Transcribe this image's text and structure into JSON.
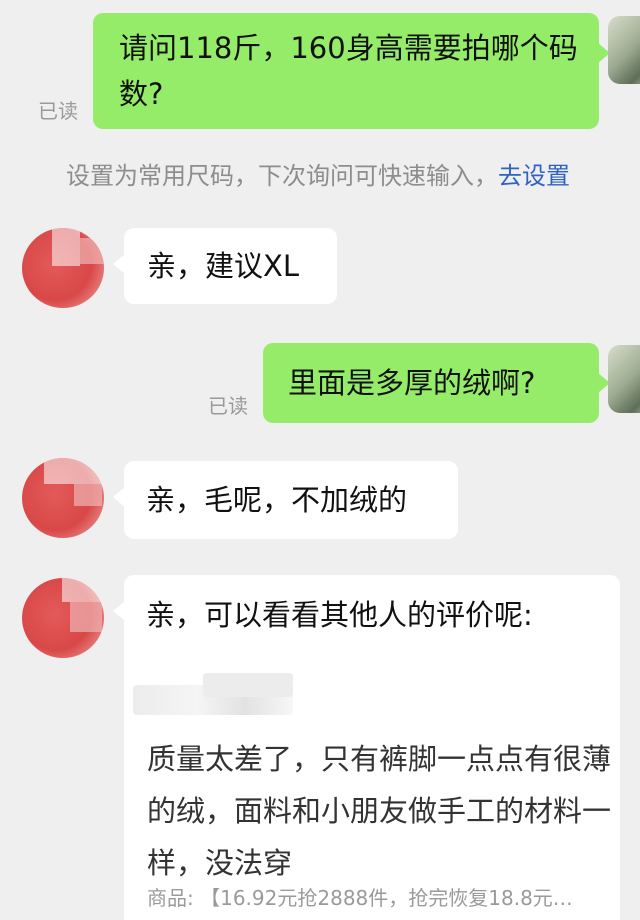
{
  "messages": {
    "q1": {
      "text": "请问118斤，160身高需要拍哪个码数?",
      "status": "已读"
    },
    "system_tip": {
      "text": "设置为常用尺码，下次询问可快速输入，",
      "link": "去设置"
    },
    "a1": {
      "text": "亲，建议XL"
    },
    "q2": {
      "text": "里面是多厚的绒啊?",
      "status": "已读"
    },
    "a2": {
      "text": "亲，毛呢，不加绒的"
    },
    "a3": {
      "text": "亲，可以看看其他人的评价呢:",
      "review": {
        "content": "质量太差了，只有裤脚一点点有很薄的绒，面料和小朋友做手工的材料一样，没法穿",
        "product_label": "商品:",
        "product_value": "【16.92元抢2888件，抢完恢复18.8元…"
      }
    }
  },
  "colors": {
    "background": "#efefef",
    "outgoing_bubble": "#95ec69",
    "incoming_bubble": "#ffffff",
    "link": "#2e63c4"
  }
}
